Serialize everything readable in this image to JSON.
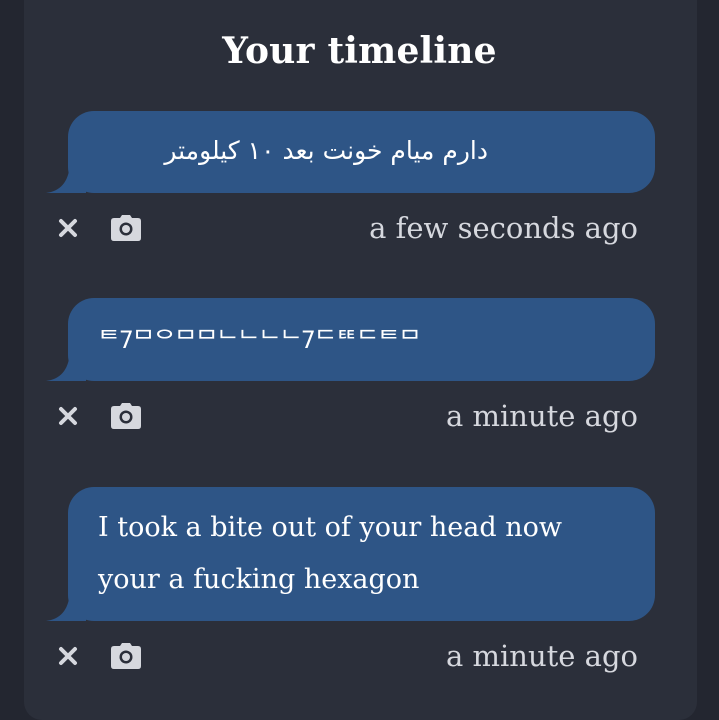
{
  "header": {
    "title": "Your timeline"
  },
  "posts": [
    {
      "text": "دارم میام خونت بعد ۱۰ کیلومتر",
      "time": "a few seconds ago"
    },
    {
      "text": "ᄐ7ᄆᄋᄆᄆᄂᄂᄂᄂ7ᄃᄐᄐᄃᄐᄆ",
      "time": "a minute ago"
    },
    {
      "text": "I took a bite out of your head now your a fucking hexagon",
      "time": "a minute ago"
    }
  ],
  "icons": {
    "delete": "close-icon",
    "camera": "camera-icon"
  },
  "colors": {
    "background": "#2b2f3a",
    "bubble": "#2e5586",
    "text": "#ffffff",
    "muted": "#d6d8de"
  }
}
